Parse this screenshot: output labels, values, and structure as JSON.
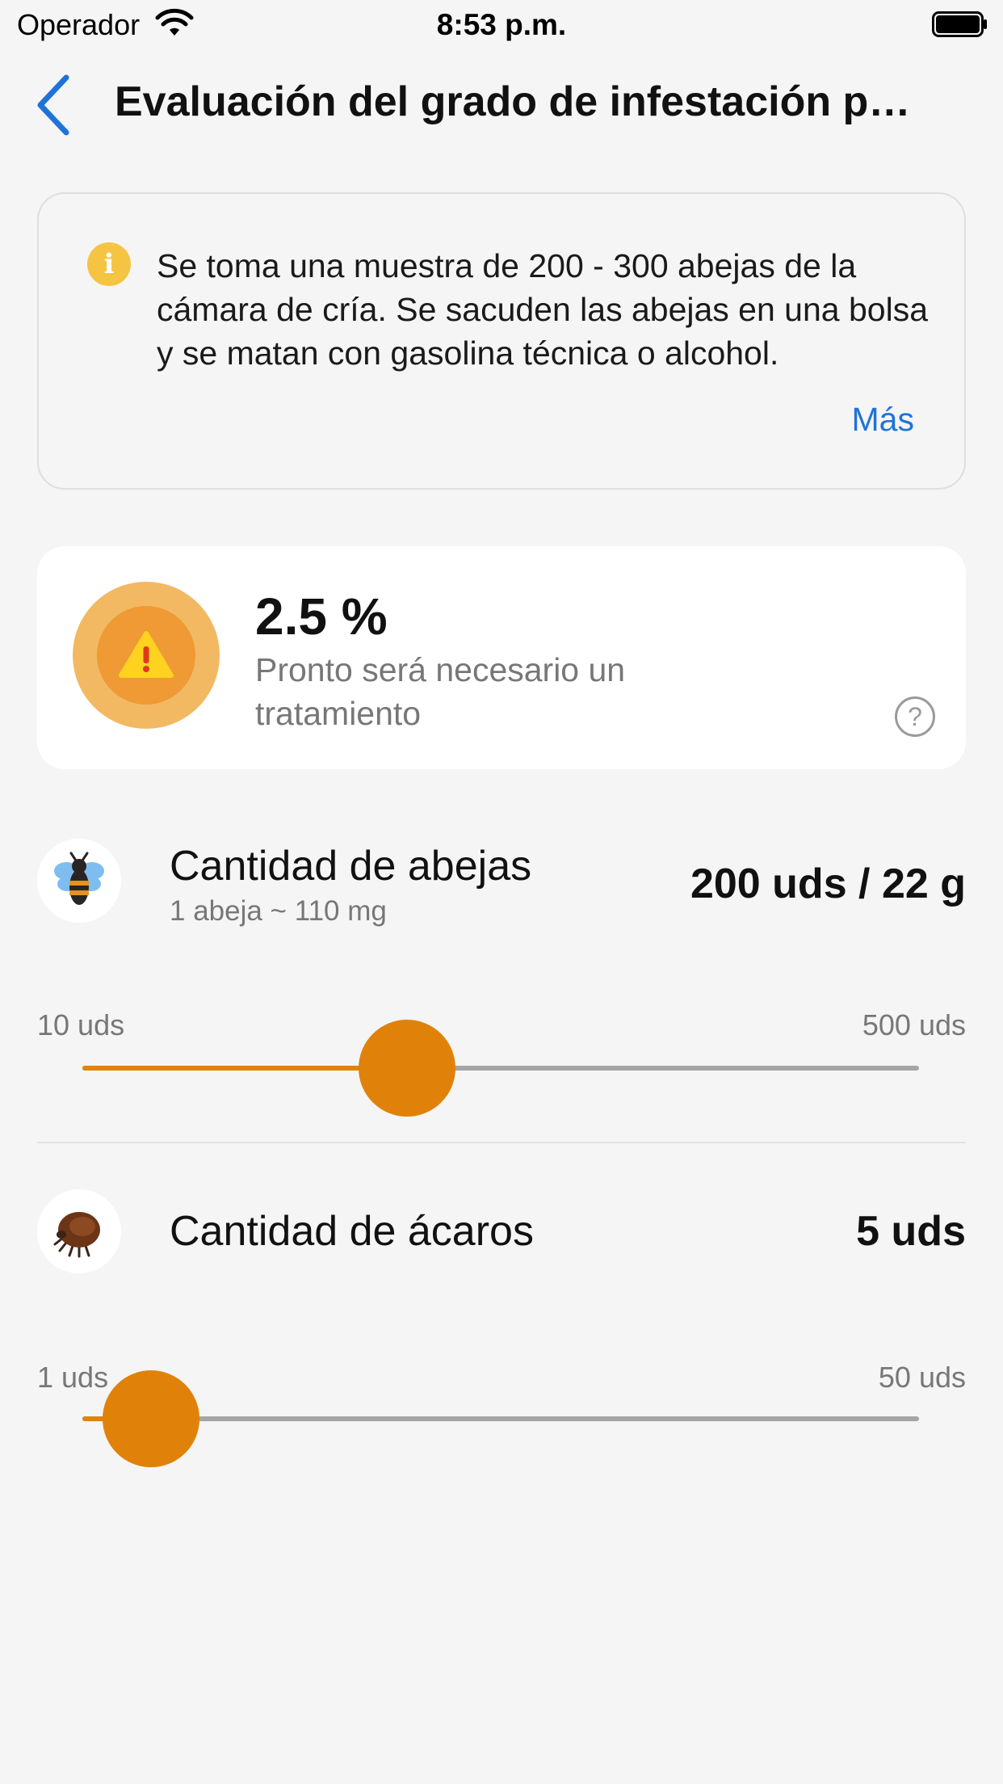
{
  "status_bar": {
    "carrier": "Operador",
    "time": "8:53 p.m.",
    "wifi_icon": "wifi-icon",
    "battery_icon": "battery-icon"
  },
  "nav": {
    "back_icon": "chevron-left-icon",
    "title": "Evaluación del grado de infestación por ácaros"
  },
  "info": {
    "icon": "info-icon",
    "text": "Se toma una muestra de 200 - 300 abejas de la cámara de cría. Se sacuden las abejas en una bolsa y se matan con gasolina técnica o alcohol.",
    "more_label": "Más"
  },
  "result": {
    "percent": "2.5 %",
    "message": "Pronto será necesario un tratamiento",
    "badge_icon": "warning-icon",
    "help_icon": "question-circle-icon",
    "colors": {
      "badge_outer": "#f2b962",
      "badge_inner": "#ef9a35",
      "warning": "#ffd21f"
    }
  },
  "bees": {
    "icon": "bee-icon",
    "label": "Cantidad de abejas",
    "sublabel": "1 abeja ~ 110 mg",
    "value": "200 uds / 22 g",
    "range_min": "10 uds",
    "range_max": "500 uds",
    "slider_value": 200,
    "slider_min": 10,
    "slider_max": 500
  },
  "mites": {
    "icon": "mite-icon",
    "label": "Cantidad de ácaros",
    "value": "5 uds",
    "range_min": "1 uds",
    "range_max": "50 uds",
    "slider_value": 5,
    "slider_min": 1,
    "slider_max": 50
  },
  "colors": {
    "accent": "#e0840a",
    "link": "#1f73d7",
    "track": "#a5a5a5",
    "background": "#f5f5f5"
  }
}
